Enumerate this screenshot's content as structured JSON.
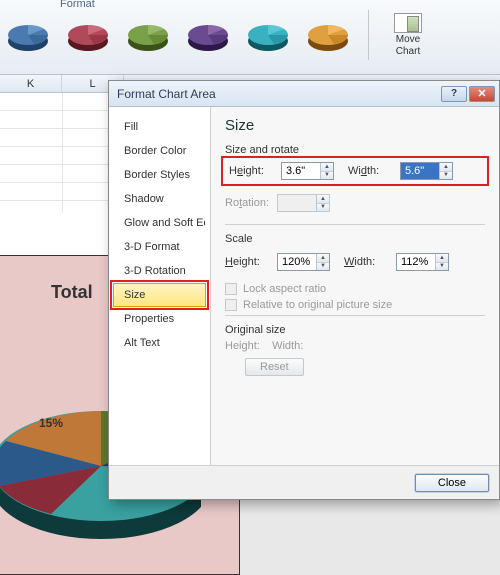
{
  "ribbon": {
    "tab_label": "Format",
    "styles": [
      {
        "base": "#2b5a8a",
        "top": "#4a7ab0"
      },
      {
        "base": "#8a2b3a",
        "top": "#b04a5a"
      },
      {
        "base": "#5a7a2b",
        "top": "#7aa04a"
      },
      {
        "base": "#4a2b6a",
        "top": "#6a4a90"
      },
      {
        "base": "#1f8a9a",
        "top": "#3ab0c0"
      },
      {
        "base": "#c07a1f",
        "top": "#e0a040"
      }
    ],
    "move_chart": {
      "line1": "Move",
      "line2": "Chart"
    }
  },
  "columns": [
    "K",
    "L"
  ],
  "embedded_chart": {
    "title": "Total",
    "labels": {
      "p15": "15%"
    }
  },
  "dialog": {
    "title": "Format Chart Area",
    "help_glyph": "?",
    "close_glyph": "✕",
    "categories": [
      "Fill",
      "Border Color",
      "Border Styles",
      "Shadow",
      "Glow and Soft Edges",
      "3-D Format",
      "3-D Rotation",
      "Size",
      "Properties",
      "Alt Text"
    ],
    "selected_category": "Size",
    "panel": {
      "heading": "Size",
      "group_size_rotate": "Size and rotate",
      "height_label": "Height:",
      "height_value": "3.6\"",
      "width_label": "Width:",
      "width_value": "5.6\"",
      "rotation_label": "Rotation:",
      "rotation_value": "",
      "group_scale": "Scale",
      "scale_height_label": "Height:",
      "scale_height_value": "120%",
      "scale_width_label": "Width:",
      "scale_width_value": "112%",
      "lock_aspect": "Lock aspect ratio",
      "relative_orig": "Relative to original picture size",
      "group_original": "Original size",
      "orig_height": "Height:",
      "orig_width": "Width:",
      "reset": "Reset"
    },
    "close_button": "Close"
  }
}
